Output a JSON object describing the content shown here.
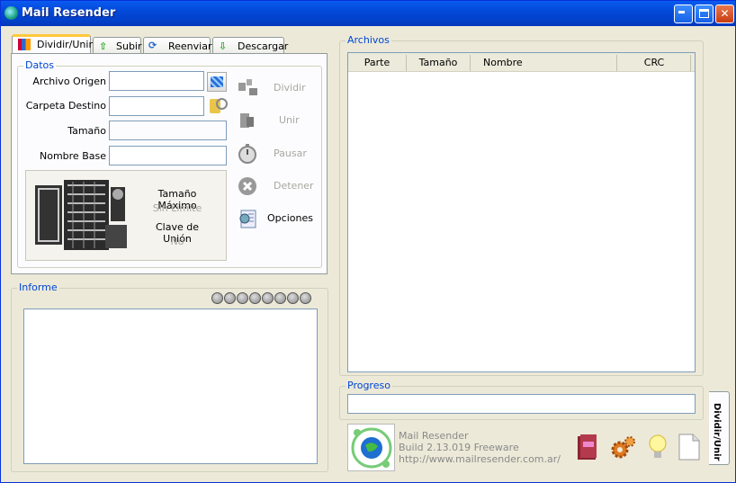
{
  "window": {
    "title": "Mail Resender",
    "minimize": "_",
    "maximize": "□",
    "close": "✕"
  },
  "tabs": [
    {
      "label": "Dividir/Unir"
    },
    {
      "label": "Subir"
    },
    {
      "label": "Reenviar"
    },
    {
      "label": "Descargar"
    }
  ],
  "datos": {
    "legend": "Datos",
    "archivo_origen_label": "Archivo Origen",
    "carpeta_destino_label": "Carpeta Destino",
    "tamano_label": "Tamaño",
    "nombre_base_label": "Nombre Base",
    "archivo_origen": "",
    "carpeta_destino": "",
    "tamano": "",
    "nombre_base": ""
  },
  "info": {
    "max_size_label": "Tamaño Máximo",
    "max_size_value": "Sin Límite",
    "key_label": "Clave de Unión",
    "key_value": "No"
  },
  "actions": {
    "dividir": "Dividir",
    "unir": "Unir",
    "pausar": "Pausar",
    "detener": "Detener",
    "opciones": "Opciones"
  },
  "informe": {
    "legend": "Informe",
    "led_count": 8
  },
  "archivos": {
    "legend": "Archivos",
    "columns": [
      "Parte",
      "Tamaño",
      "Nombre",
      "CRC"
    ]
  },
  "progreso": {
    "legend": "Progreso",
    "value": 0
  },
  "footer": {
    "app_name": "Mail Resender",
    "build": "Build 2.13.019 Freeware",
    "url": "http://www.mailresender.com.ar/"
  },
  "side_tab": {
    "label": "Dividir/Unir"
  }
}
